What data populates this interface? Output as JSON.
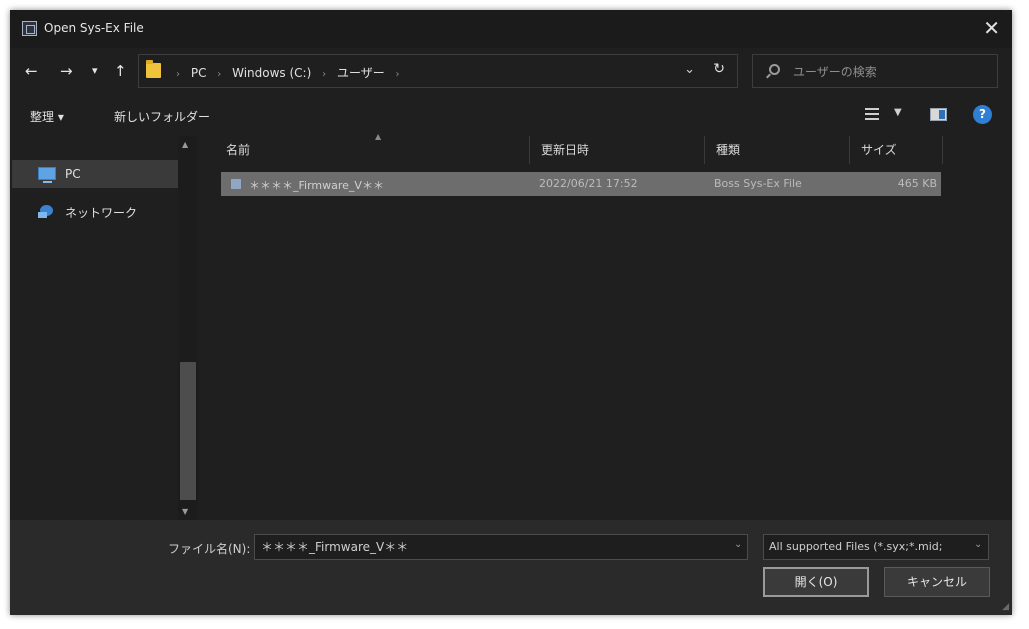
{
  "window": {
    "title": "Open Sys-Ex File",
    "close_glyph": "✕"
  },
  "nav": {
    "back_glyph": "←",
    "forward_glyph": "→",
    "recent_glyph": "▾",
    "up_glyph": "↑",
    "breadcrumbs": [
      "PC",
      "Windows (C:)",
      "ユーザー"
    ],
    "address_dropdown_glyph": "⌄",
    "refresh_glyph": "↻",
    "search_placeholder": "ユーザーの検索"
  },
  "commands": {
    "organize_label": "整理 ▾",
    "new_folder_label": "新しいフォルダー"
  },
  "sidebar": {
    "items": [
      {
        "label": "PC",
        "icon": "pc-icon",
        "selected": true
      },
      {
        "label": "ネットワーク",
        "icon": "network-icon",
        "selected": false
      }
    ]
  },
  "filelist": {
    "columns": [
      "名前",
      "更新日時",
      "種類",
      "サイズ"
    ],
    "rows": [
      {
        "name": "＊＊＊＊_Firmware_V＊＊",
        "modified": "2022/06/21 17:52",
        "type": "Boss Sys-Ex File",
        "size": "465 KB",
        "selected": true
      }
    ]
  },
  "footer": {
    "filename_label": "ファイル名(N):",
    "filename_value": "＊＊＊＊_Firmware_V＊＊",
    "filter_value": "All supported Files (*.syx;*.mid;",
    "open_label": "開く(O)",
    "cancel_label": "キャンセル"
  },
  "colors": {
    "window_bg": "#1f1f1f",
    "selection_bg": "#6d6d6d",
    "footer_bg": "#2a2a2a",
    "accent_blue": "#2f7fd4"
  }
}
